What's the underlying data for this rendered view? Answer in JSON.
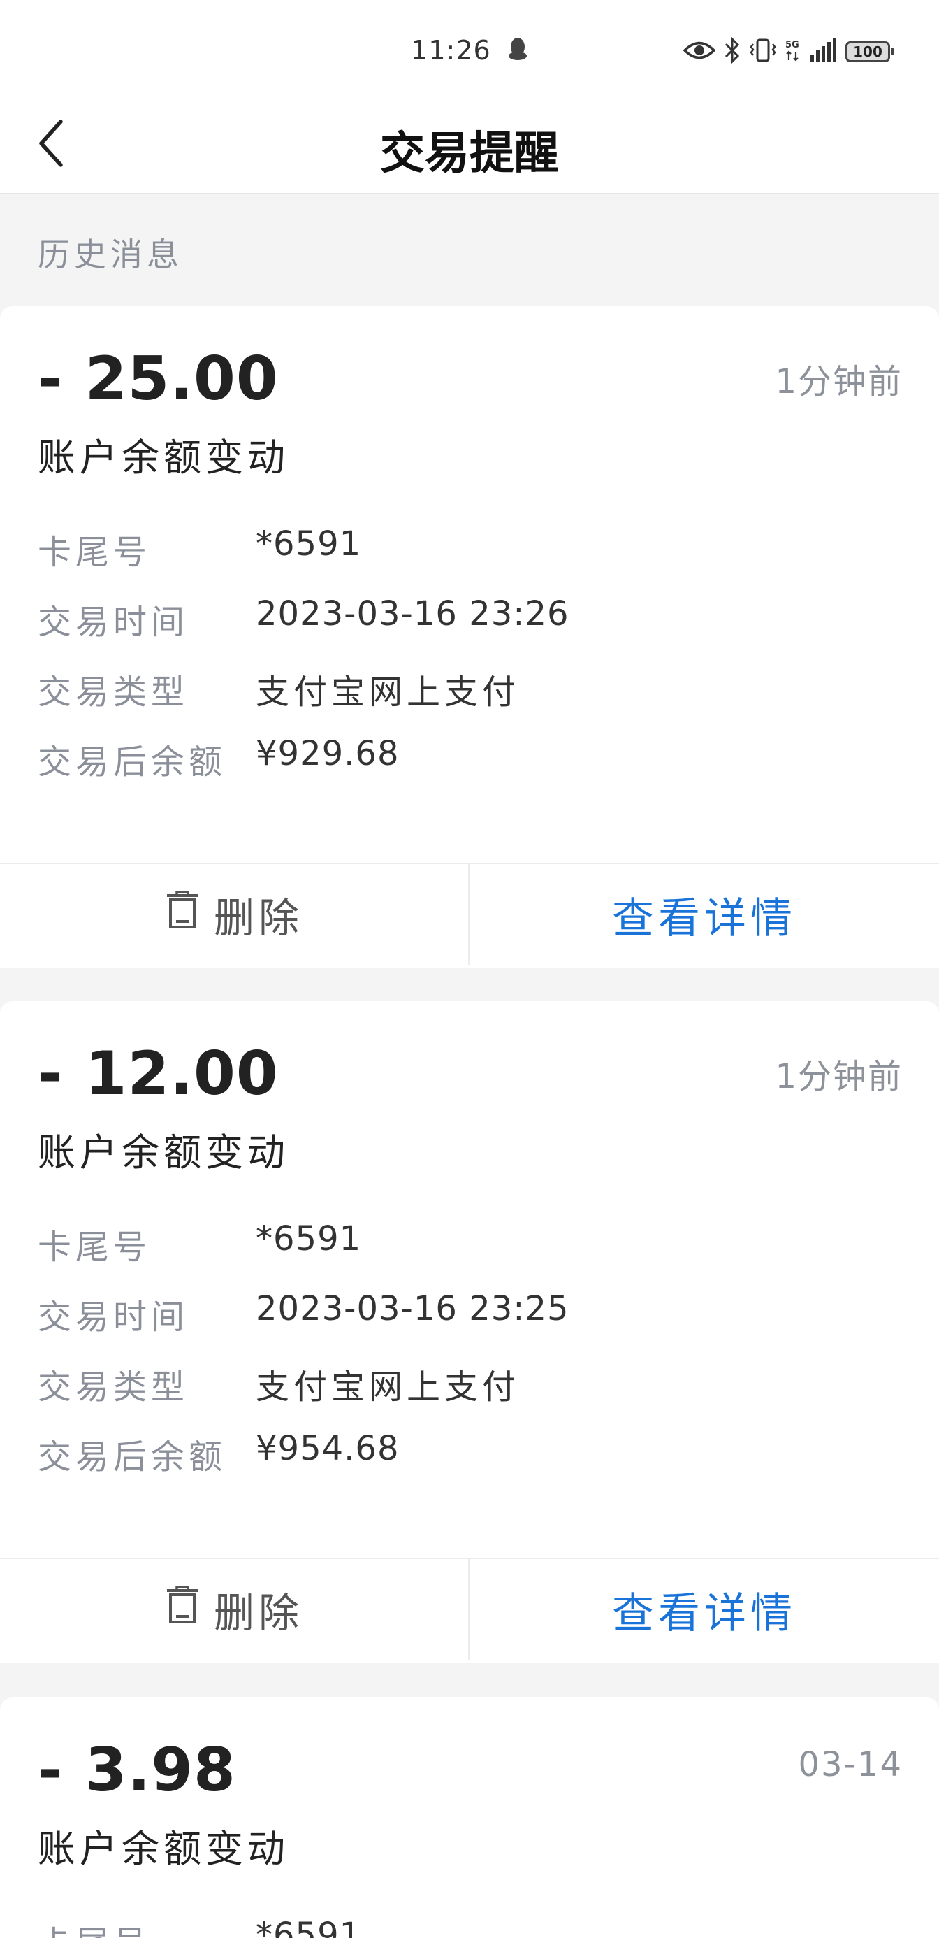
{
  "status_bar": {
    "time": "11:26",
    "battery": "100",
    "icons": [
      "qq-penguin-icon",
      "eye-icon",
      "bluetooth-icon",
      "vibrate-icon",
      "5g-icon",
      "signal-icon",
      "battery-icon"
    ]
  },
  "header": {
    "title": "交易提醒",
    "back_icon": "chevron-left-icon"
  },
  "section_label": "历史消息",
  "labels": {
    "card_no": "卡尾号",
    "trade_time": "交易时间",
    "trade_type": "交易类型",
    "balance_after": "交易后余额",
    "delete": "删除",
    "view_detail": "查看详情"
  },
  "colors": {
    "accent": "#1a73d9",
    "label_gray": "#8a8f99",
    "background": "#f4f4f4"
  },
  "messages": [
    {
      "amount": "- 25.00",
      "time_ago": "1分钟前",
      "subtitle": "账户余额变动",
      "card_no": "*6591",
      "trade_time": "2023-03-16 23:26",
      "trade_type": "支付宝网上支付",
      "balance_after": "¥929.68"
    },
    {
      "amount": "- 12.00",
      "time_ago": "1分钟前",
      "subtitle": "账户余额变动",
      "card_no": "*6591",
      "trade_time": "2023-03-16 23:25",
      "trade_type": "支付宝网上支付",
      "balance_after": "¥954.68"
    },
    {
      "amount": "- 3.98",
      "time_ago": "03-14",
      "subtitle": "账户余额变动",
      "card_no": "*6591"
    }
  ]
}
